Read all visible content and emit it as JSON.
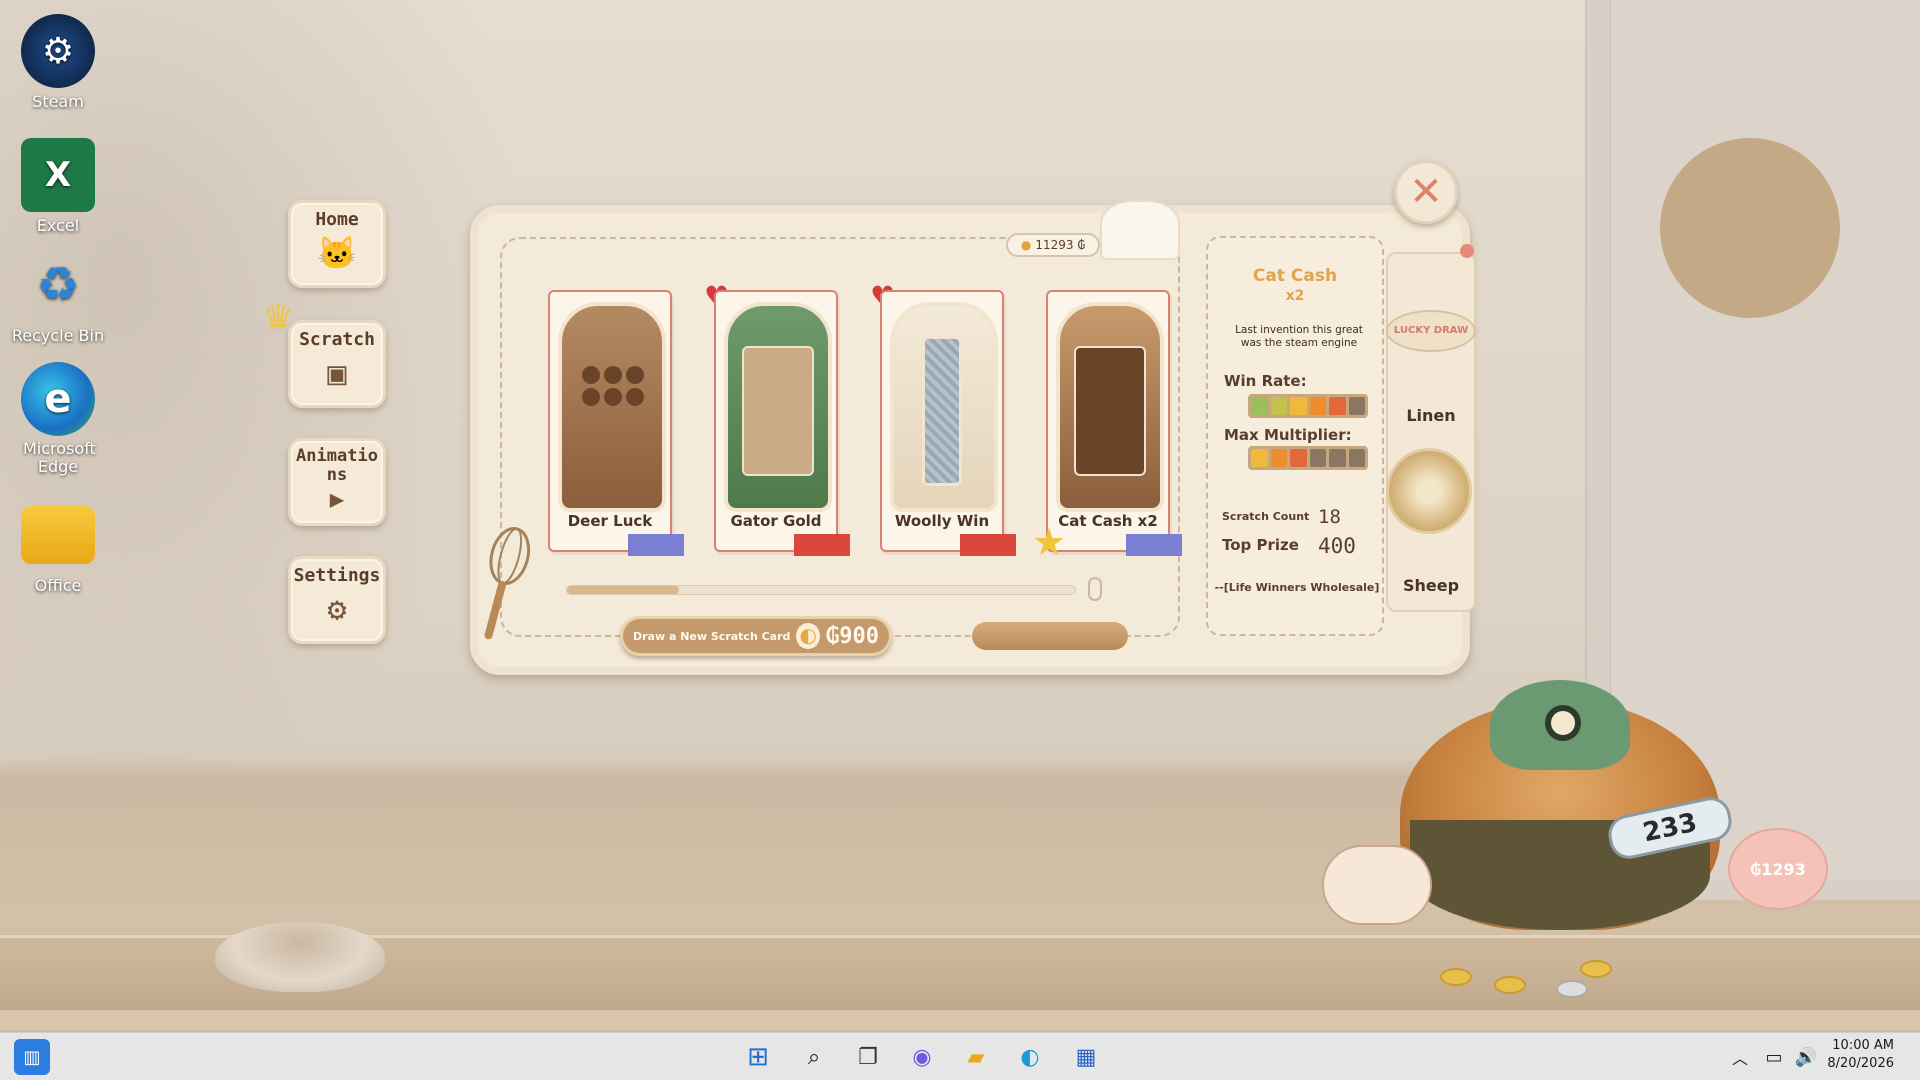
{
  "desktop": {
    "icons": [
      {
        "label": "Steam",
        "glyph": "⚙"
      },
      {
        "label": "Excel",
        "glyph": "X"
      },
      {
        "label": "Recycle Bin",
        "glyph": "♻"
      },
      {
        "label": "Microsoft Edge",
        "glyph": "e"
      },
      {
        "label": "Office",
        "glyph": ""
      }
    ]
  },
  "nav": {
    "home": "Home",
    "scratch": "Scratch",
    "animations": "Animatio ns",
    "settings": "Settings"
  },
  "game": {
    "coins": "11293",
    "currency_symbol": "₲",
    "close_glyph": "✕",
    "cards": [
      {
        "name": "Deer Luck",
        "ribbon_color": "#7b7fd4",
        "heart": "♡"
      },
      {
        "name": "Gator Gold",
        "ribbon_color": "#d9483b",
        "heart": "♥"
      },
      {
        "name": "Woolly Win",
        "ribbon_color": "#d9483b",
        "heart": "♥"
      },
      {
        "name": "Cat Cash x2",
        "ribbon_color": "#7b7fd4",
        "heart": "♡"
      }
    ],
    "progress": 0.22,
    "draw_button": {
      "label": "Draw a New Scratch Card",
      "price": "₲900"
    },
    "info": {
      "title": "Cat Cash",
      "subtitle": "x2",
      "description": "Last invention this great was the steam engine",
      "win_rate_label": "Win Rate:",
      "win_rate_colors": [
        "#9cbf5a",
        "#c3c24b",
        "#f0b93c",
        "#ee8d2d",
        "#e2683a",
        "#8b7563"
      ],
      "max_mult_label": "Max Multiplier:",
      "max_mult_colors": [
        "#f0b93c",
        "#ee8d2d",
        "#e2683a",
        "#8b7563",
        "#8b7563",
        "#8b7563"
      ],
      "scratch_count_label": "Scratch Count",
      "scratch_count": "18",
      "top_prize_label": "Top Prize",
      "top_prize": "400",
      "footer": "--[Life Winners Wholesale]"
    },
    "side": {
      "lucky_draw": "LUCKY DRAW",
      "linen": "Linen",
      "sheep": "Sheep"
    },
    "mascot": {
      "bottle_count": "233",
      "piggy_bank": "₲1293"
    }
  },
  "taskbar": {
    "time": "10:00 AM",
    "date": "8/20/2026"
  }
}
